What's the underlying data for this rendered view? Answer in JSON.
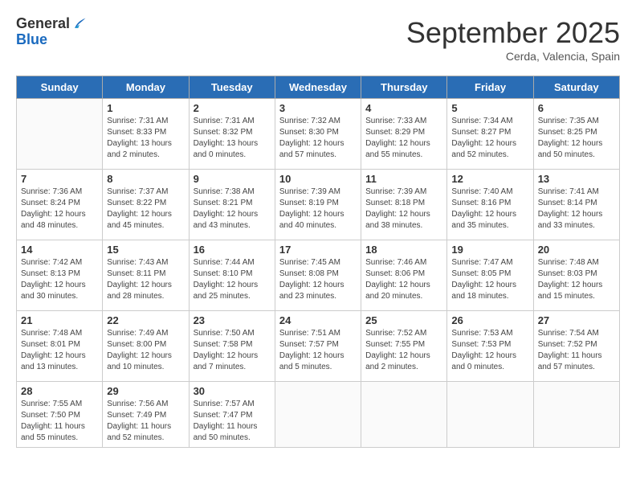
{
  "logo": {
    "general": "General",
    "blue": "Blue"
  },
  "title": "September 2025",
  "subtitle": "Cerda, Valencia, Spain",
  "days_of_week": [
    "Sunday",
    "Monday",
    "Tuesday",
    "Wednesday",
    "Thursday",
    "Friday",
    "Saturday"
  ],
  "weeks": [
    [
      {
        "day": "",
        "sunrise": "",
        "sunset": "",
        "daylight": ""
      },
      {
        "day": "1",
        "sunrise": "Sunrise: 7:31 AM",
        "sunset": "Sunset: 8:33 PM",
        "daylight": "Daylight: 13 hours and 2 minutes."
      },
      {
        "day": "2",
        "sunrise": "Sunrise: 7:31 AM",
        "sunset": "Sunset: 8:32 PM",
        "daylight": "Daylight: 13 hours and 0 minutes."
      },
      {
        "day": "3",
        "sunrise": "Sunrise: 7:32 AM",
        "sunset": "Sunset: 8:30 PM",
        "daylight": "Daylight: 12 hours and 57 minutes."
      },
      {
        "day": "4",
        "sunrise": "Sunrise: 7:33 AM",
        "sunset": "Sunset: 8:29 PM",
        "daylight": "Daylight: 12 hours and 55 minutes."
      },
      {
        "day": "5",
        "sunrise": "Sunrise: 7:34 AM",
        "sunset": "Sunset: 8:27 PM",
        "daylight": "Daylight: 12 hours and 52 minutes."
      },
      {
        "day": "6",
        "sunrise": "Sunrise: 7:35 AM",
        "sunset": "Sunset: 8:25 PM",
        "daylight": "Daylight: 12 hours and 50 minutes."
      }
    ],
    [
      {
        "day": "7",
        "sunrise": "Sunrise: 7:36 AM",
        "sunset": "Sunset: 8:24 PM",
        "daylight": "Daylight: 12 hours and 48 minutes."
      },
      {
        "day": "8",
        "sunrise": "Sunrise: 7:37 AM",
        "sunset": "Sunset: 8:22 PM",
        "daylight": "Daylight: 12 hours and 45 minutes."
      },
      {
        "day": "9",
        "sunrise": "Sunrise: 7:38 AM",
        "sunset": "Sunset: 8:21 PM",
        "daylight": "Daylight: 12 hours and 43 minutes."
      },
      {
        "day": "10",
        "sunrise": "Sunrise: 7:39 AM",
        "sunset": "Sunset: 8:19 PM",
        "daylight": "Daylight: 12 hours and 40 minutes."
      },
      {
        "day": "11",
        "sunrise": "Sunrise: 7:39 AM",
        "sunset": "Sunset: 8:18 PM",
        "daylight": "Daylight: 12 hours and 38 minutes."
      },
      {
        "day": "12",
        "sunrise": "Sunrise: 7:40 AM",
        "sunset": "Sunset: 8:16 PM",
        "daylight": "Daylight: 12 hours and 35 minutes."
      },
      {
        "day": "13",
        "sunrise": "Sunrise: 7:41 AM",
        "sunset": "Sunset: 8:14 PM",
        "daylight": "Daylight: 12 hours and 33 minutes."
      }
    ],
    [
      {
        "day": "14",
        "sunrise": "Sunrise: 7:42 AM",
        "sunset": "Sunset: 8:13 PM",
        "daylight": "Daylight: 12 hours and 30 minutes."
      },
      {
        "day": "15",
        "sunrise": "Sunrise: 7:43 AM",
        "sunset": "Sunset: 8:11 PM",
        "daylight": "Daylight: 12 hours and 28 minutes."
      },
      {
        "day": "16",
        "sunrise": "Sunrise: 7:44 AM",
        "sunset": "Sunset: 8:10 PM",
        "daylight": "Daylight: 12 hours and 25 minutes."
      },
      {
        "day": "17",
        "sunrise": "Sunrise: 7:45 AM",
        "sunset": "Sunset: 8:08 PM",
        "daylight": "Daylight: 12 hours and 23 minutes."
      },
      {
        "day": "18",
        "sunrise": "Sunrise: 7:46 AM",
        "sunset": "Sunset: 8:06 PM",
        "daylight": "Daylight: 12 hours and 20 minutes."
      },
      {
        "day": "19",
        "sunrise": "Sunrise: 7:47 AM",
        "sunset": "Sunset: 8:05 PM",
        "daylight": "Daylight: 12 hours and 18 minutes."
      },
      {
        "day": "20",
        "sunrise": "Sunrise: 7:48 AM",
        "sunset": "Sunset: 8:03 PM",
        "daylight": "Daylight: 12 hours and 15 minutes."
      }
    ],
    [
      {
        "day": "21",
        "sunrise": "Sunrise: 7:48 AM",
        "sunset": "Sunset: 8:01 PM",
        "daylight": "Daylight: 12 hours and 13 minutes."
      },
      {
        "day": "22",
        "sunrise": "Sunrise: 7:49 AM",
        "sunset": "Sunset: 8:00 PM",
        "daylight": "Daylight: 12 hours and 10 minutes."
      },
      {
        "day": "23",
        "sunrise": "Sunrise: 7:50 AM",
        "sunset": "Sunset: 7:58 PM",
        "daylight": "Daylight: 12 hours and 7 minutes."
      },
      {
        "day": "24",
        "sunrise": "Sunrise: 7:51 AM",
        "sunset": "Sunset: 7:57 PM",
        "daylight": "Daylight: 12 hours and 5 minutes."
      },
      {
        "day": "25",
        "sunrise": "Sunrise: 7:52 AM",
        "sunset": "Sunset: 7:55 PM",
        "daylight": "Daylight: 12 hours and 2 minutes."
      },
      {
        "day": "26",
        "sunrise": "Sunrise: 7:53 AM",
        "sunset": "Sunset: 7:53 PM",
        "daylight": "Daylight: 12 hours and 0 minutes."
      },
      {
        "day": "27",
        "sunrise": "Sunrise: 7:54 AM",
        "sunset": "Sunset: 7:52 PM",
        "daylight": "Daylight: 11 hours and 57 minutes."
      }
    ],
    [
      {
        "day": "28",
        "sunrise": "Sunrise: 7:55 AM",
        "sunset": "Sunset: 7:50 PM",
        "daylight": "Daylight: 11 hours and 55 minutes."
      },
      {
        "day": "29",
        "sunrise": "Sunrise: 7:56 AM",
        "sunset": "Sunset: 7:49 PM",
        "daylight": "Daylight: 11 hours and 52 minutes."
      },
      {
        "day": "30",
        "sunrise": "Sunrise: 7:57 AM",
        "sunset": "Sunset: 7:47 PM",
        "daylight": "Daylight: 11 hours and 50 minutes."
      },
      {
        "day": "",
        "sunrise": "",
        "sunset": "",
        "daylight": ""
      },
      {
        "day": "",
        "sunrise": "",
        "sunset": "",
        "daylight": ""
      },
      {
        "day": "",
        "sunrise": "",
        "sunset": "",
        "daylight": ""
      },
      {
        "day": "",
        "sunrise": "",
        "sunset": "",
        "daylight": ""
      }
    ]
  ]
}
